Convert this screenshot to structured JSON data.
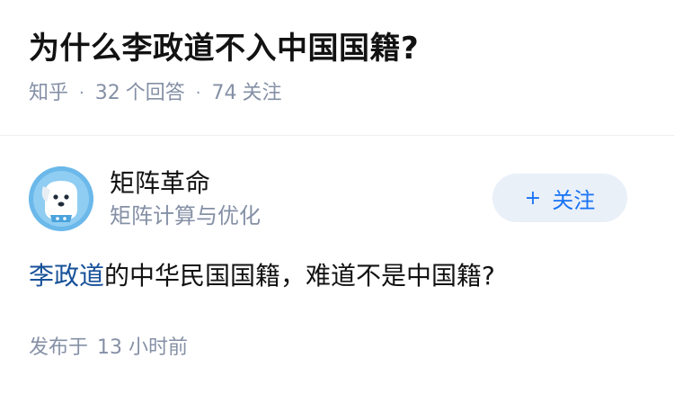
{
  "question": {
    "title": "为什么李政道不入中国国籍?",
    "source": "知乎",
    "answer_count": "32",
    "answer_label": "个回答",
    "follower_count": "74",
    "follower_label": "关注"
  },
  "answer": {
    "author_name": "矩阵革命",
    "author_headline": "矩阵计算与优化",
    "follow_label": "关注",
    "follow_icon": "plus-icon",
    "content_link": "李政道",
    "content_rest": "的中华民国国籍，难道不是中国籍?",
    "time_label": "发布于",
    "time_value": "13 小时前"
  },
  "colors": {
    "accent": "#1772f6",
    "link": "#175199",
    "meta": "#8590a6",
    "follow_bg": "#e9f0f8",
    "avatar_bg": "#6bb8ea"
  }
}
